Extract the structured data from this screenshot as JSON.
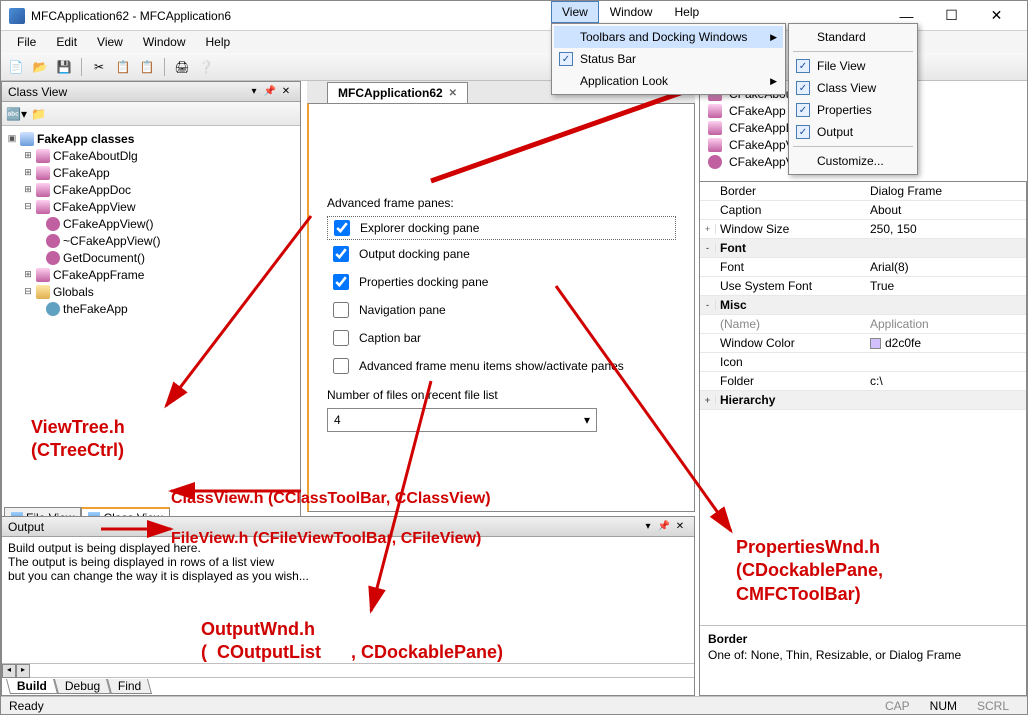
{
  "title": "MFCApplication62 - MFCApplication6",
  "menubar": [
    "File",
    "Edit",
    "View",
    "Window",
    "Help"
  ],
  "top_menu_labels": [
    "View",
    "Window",
    "Help"
  ],
  "view_menu": {
    "toolbars": "Toolbars and Docking Windows",
    "statusbar": "Status Bar",
    "applook": "Application Look"
  },
  "submenu": {
    "standard": "Standard",
    "fileview": "File View",
    "classview": "Class View",
    "properties": "Properties",
    "output": "Output",
    "customize": "Customize..."
  },
  "classview": {
    "title": "Class View",
    "root": "FakeApp classes",
    "nodes": [
      "CFakeAboutDlg",
      "CFakeApp",
      "CFakeAppDoc",
      "CFakeAppView"
    ],
    "methods": [
      "CFakeAppView()",
      "~CFakeAppView()",
      "GetDocument()"
    ],
    "frame": "CFakeAppFrame",
    "globals_label": "Globals",
    "global_var": "theFakeApp",
    "tabs": [
      "File View",
      "Class View"
    ]
  },
  "memberlist": [
    "CFakeAboutDlg",
    "CFakeApp",
    "CFakeAppDoc",
    "CFakeAppView",
    "CFakeAppView()"
  ],
  "doc": {
    "tab": "MFCApplication62",
    "section": "Advanced frame panes:",
    "opts": [
      {
        "label": "Explorer docking pane",
        "chk": true
      },
      {
        "label": "Output docking pane",
        "chk": true
      },
      {
        "label": "Properties docking pane",
        "chk": true
      },
      {
        "label": "Navigation pane",
        "chk": false
      },
      {
        "label": "Caption bar",
        "chk": false
      },
      {
        "label": "Advanced frame menu items show/activate panes",
        "chk": false
      }
    ],
    "recent_label": "Number of files on recent file list",
    "recent_value": "4"
  },
  "output": {
    "title": "Output",
    "lines": [
      "Build output is being displayed here.",
      "The output is being displayed in rows of a list view",
      "but you can change the way it is displayed as you wish..."
    ],
    "tabs": [
      "Build",
      "Debug",
      "Find"
    ]
  },
  "props": {
    "rows": [
      {
        "cat": false,
        "k": "Border",
        "v": "Dialog Frame"
      },
      {
        "cat": false,
        "k": "Caption",
        "v": "About"
      },
      {
        "cat": false,
        "exp": "+",
        "k": "Window Size",
        "v": "250, 150"
      },
      {
        "cat": true,
        "exp": "-",
        "k": "Font",
        "v": ""
      },
      {
        "cat": false,
        "k": "Font",
        "v": "Arial(8)"
      },
      {
        "cat": false,
        "k": "Use System Font",
        "v": "True"
      },
      {
        "cat": true,
        "exp": "-",
        "k": "Misc",
        "v": ""
      },
      {
        "cat": false,
        "k": "(Name)",
        "v": "Application",
        "grey": true
      },
      {
        "cat": false,
        "k": "Window Color",
        "v": "d2c0fe",
        "color": true
      },
      {
        "cat": false,
        "k": "Icon",
        "v": ""
      },
      {
        "cat": false,
        "k": "Folder",
        "v": "c:\\"
      },
      {
        "cat": true,
        "exp": "+",
        "k": "Hierarchy",
        "v": ""
      }
    ],
    "desc_h": "Border",
    "desc_b": "One of: None, Thin, Resizable, or Dialog Frame"
  },
  "annotations": {
    "viewtree": "ViewTree.h\n(CTreeCtrl)",
    "classview_a": "ClassView.h (CClassToolBar, CClassView)",
    "fileview_a": "FileView.h (CFileViewToolBar, CFileView)",
    "output_a": "OutputWnd.h\n(  COutputList      , CDockablePane)",
    "props_a": "PropertiesWnd.h\n(CDockablePane,\nCMFCToolBar)"
  },
  "status": {
    "ready": "Ready",
    "cap": "CAP",
    "num": "NUM",
    "scrl": "SCRL"
  }
}
